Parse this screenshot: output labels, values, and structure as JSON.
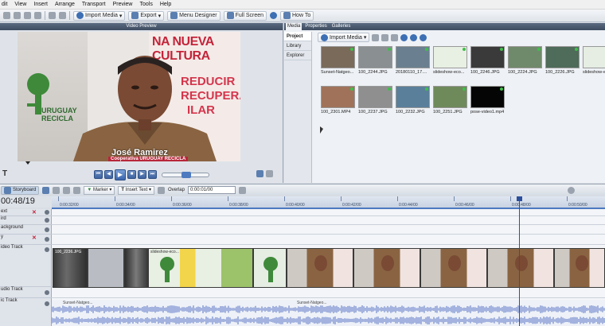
{
  "menu": [
    "dit",
    "View",
    "Insert",
    "Arrange",
    "Transport",
    "Preview",
    "Tools",
    "Help"
  ],
  "toolbar": {
    "import_media": "Import Media",
    "export": "Export",
    "menu_designer": "Menu Designer",
    "full_screen": "Full Screen",
    "how_to": "How To"
  },
  "preview": {
    "title": "Video Preview",
    "poster_lines": [
      "NA NUEVA",
      "CULTURA",
      "REDUCIR",
      "RECUPERAR",
      "ILAR"
    ],
    "logo_text": [
      "URUGUAY",
      "RECICLA"
    ],
    "name": "José Ramirez",
    "org": "Cooperativa URUGUAY RECICLA",
    "text_tool": "T"
  },
  "media": {
    "tabs": [
      "Media",
      "Properties",
      "Galleries"
    ],
    "nav": [
      "Project",
      "Library",
      "Explorer"
    ],
    "import_label": "Import Media",
    "items": [
      {
        "label": "Sunset-Natgeo...",
        "color": "#7a6a5a"
      },
      {
        "label": "100_2244.JPG",
        "color": "#8a8f92"
      },
      {
        "label": "20180110_17....",
        "color": "#6a8090"
      },
      {
        "label": "slideshow-eco...",
        "color": "#e8efe3"
      },
      {
        "label": "100_2246.JPG",
        "color": "#3a3a3a"
      },
      {
        "label": "100_2224.JPG",
        "color": "#6f8a6a"
      },
      {
        "label": "100_2226.JPG",
        "color": "#4f6b5a"
      },
      {
        "label": "slideshow-eco...",
        "color": "#e6ede3"
      },
      {
        "label": "100_2301.MP4",
        "color": "#a0725a"
      },
      {
        "label": "100_2237.JPG",
        "color": "#8f8f8f"
      },
      {
        "label": "100_2232.JPG",
        "color": "#5a7f9a"
      },
      {
        "label": "100_2251.JPG",
        "color": "#6f8a5a"
      },
      {
        "label": "pose-video1.mp4",
        "color": "#050505"
      }
    ]
  },
  "timeline": {
    "storyboard": "Storyboard",
    "marker": "Marker",
    "insert_text": "Insert Text",
    "overlap": "Overlap",
    "overlap_value": "0:00:01/00",
    "timecode": "00:48/19",
    "ruler": [
      "0:00:32/00",
      "0:00:34/00",
      "0:00:36/00",
      "0:00:38/00",
      "0:00:40/00",
      "0:00:42/00",
      "0:00:44/00",
      "0:00:46/00",
      "0:00:48/00",
      "0:00:50/00"
    ],
    "tracks": [
      "ext",
      "ird",
      "ackground",
      "y",
      "ideo Track",
      "udio Track",
      "ic Track"
    ],
    "clip_label": "100_2236.JPG",
    "clip_label2": "slideshow-eco...",
    "audio_label": "Sunset-Natgeo..."
  }
}
